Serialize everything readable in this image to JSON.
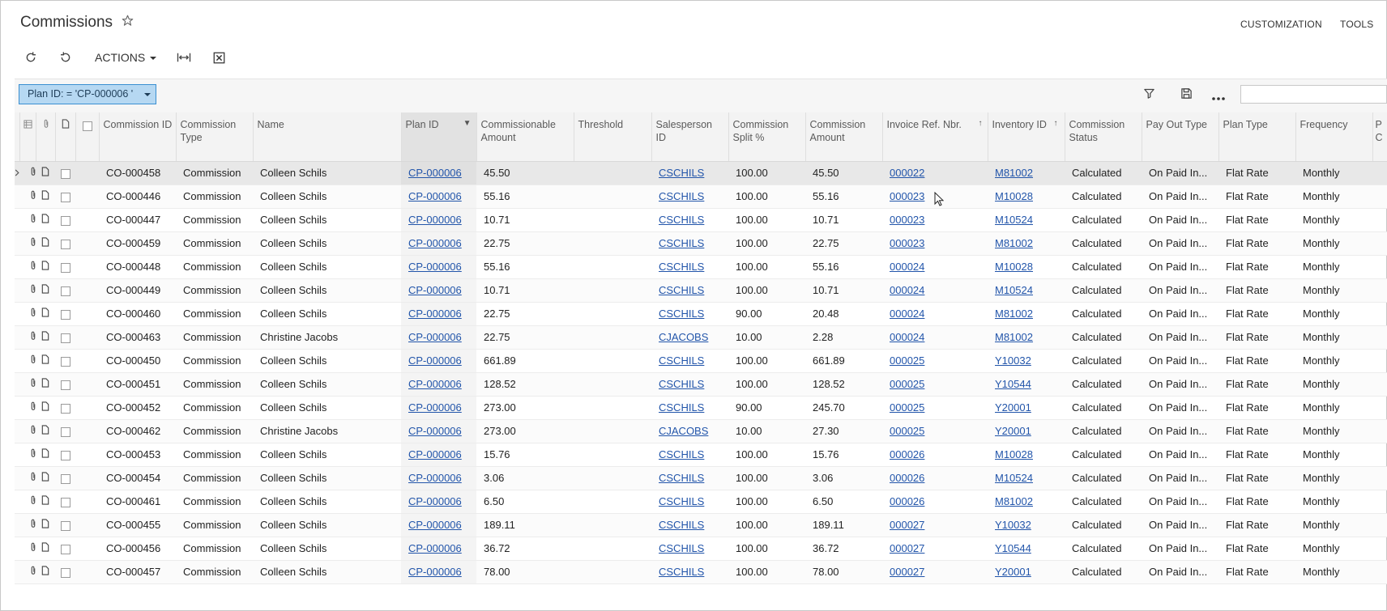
{
  "header": {
    "title": "Commissions",
    "links": [
      "CUSTOMIZATION",
      "TOOLS"
    ]
  },
  "toolbar": {
    "actions_label": "ACTIONS"
  },
  "filter": {
    "chip_label": "Plan ID: = 'CP-000006 '",
    "search_value": ""
  },
  "columns": {
    "commission_id": "Commission ID",
    "commission_type": "Commission Type",
    "name": "Name",
    "plan_id": "Plan ID",
    "commissionable_amount": "Commissionable Amount",
    "threshold": "Threshold",
    "salesperson_id": "Salesperson ID",
    "commission_split": "Commission Split %",
    "commission_amount": "Commission Amount",
    "invoice_ref": "Invoice Ref. Nbr.",
    "inventory_id": "Inventory ID",
    "commission_status": "Commission Status",
    "pay_out_type": "Pay Out Type",
    "plan_type": "Plan Type",
    "frequency": "Frequency",
    "extra": "P C"
  },
  "rows": [
    {
      "id": "CO-000458",
      "type": "Commission",
      "name": "Colleen Schils",
      "plan": "CP-000006",
      "commissionable": "45.50",
      "threshold": "",
      "salesperson": "CSCHILS",
      "split": "100.00",
      "amount": "45.50",
      "invoice": "000022",
      "inventory": "M81002",
      "status": "Calculated",
      "payout": "On Paid In...",
      "plantype": "Flat Rate",
      "frequency": "Monthly"
    },
    {
      "id": "CO-000446",
      "type": "Commission",
      "name": "Colleen Schils",
      "plan": "CP-000006",
      "commissionable": "55.16",
      "threshold": "",
      "salesperson": "CSCHILS",
      "split": "100.00",
      "amount": "55.16",
      "invoice": "000023",
      "inventory": "M10028",
      "status": "Calculated",
      "payout": "On Paid In...",
      "plantype": "Flat Rate",
      "frequency": "Monthly"
    },
    {
      "id": "CO-000447",
      "type": "Commission",
      "name": "Colleen Schils",
      "plan": "CP-000006",
      "commissionable": "10.71",
      "threshold": "",
      "salesperson": "CSCHILS",
      "split": "100.00",
      "amount": "10.71",
      "invoice": "000023",
      "inventory": "M10524",
      "status": "Calculated",
      "payout": "On Paid In...",
      "plantype": "Flat Rate",
      "frequency": "Monthly"
    },
    {
      "id": "CO-000459",
      "type": "Commission",
      "name": "Colleen Schils",
      "plan": "CP-000006",
      "commissionable": "22.75",
      "threshold": "",
      "salesperson": "CSCHILS",
      "split": "100.00",
      "amount": "22.75",
      "invoice": "000023",
      "inventory": "M81002",
      "status": "Calculated",
      "payout": "On Paid In...",
      "plantype": "Flat Rate",
      "frequency": "Monthly"
    },
    {
      "id": "CO-000448",
      "type": "Commission",
      "name": "Colleen Schils",
      "plan": "CP-000006",
      "commissionable": "55.16",
      "threshold": "",
      "salesperson": "CSCHILS",
      "split": "100.00",
      "amount": "55.16",
      "invoice": "000024",
      "inventory": "M10028",
      "status": "Calculated",
      "payout": "On Paid In...",
      "plantype": "Flat Rate",
      "frequency": "Monthly"
    },
    {
      "id": "CO-000449",
      "type": "Commission",
      "name": "Colleen Schils",
      "plan": "CP-000006",
      "commissionable": "10.71",
      "threshold": "",
      "salesperson": "CSCHILS",
      "split": "100.00",
      "amount": "10.71",
      "invoice": "000024",
      "inventory": "M10524",
      "status": "Calculated",
      "payout": "On Paid In...",
      "plantype": "Flat Rate",
      "frequency": "Monthly"
    },
    {
      "id": "CO-000460",
      "type": "Commission",
      "name": "Colleen Schils",
      "plan": "CP-000006",
      "commissionable": "22.75",
      "threshold": "",
      "salesperson": "CSCHILS",
      "split": "90.00",
      "amount": "20.48",
      "invoice": "000024",
      "inventory": "M81002",
      "status": "Calculated",
      "payout": "On Paid In...",
      "plantype": "Flat Rate",
      "frequency": "Monthly"
    },
    {
      "id": "CO-000463",
      "type": "Commission",
      "name": "Christine Jacobs",
      "plan": "CP-000006",
      "commissionable": "22.75",
      "threshold": "",
      "salesperson": "CJACOBS",
      "split": "10.00",
      "amount": "2.28",
      "invoice": "000024",
      "inventory": "M81002",
      "status": "Calculated",
      "payout": "On Paid In...",
      "plantype": "Flat Rate",
      "frequency": "Monthly"
    },
    {
      "id": "CO-000450",
      "type": "Commission",
      "name": "Colleen Schils",
      "plan": "CP-000006",
      "commissionable": "661.89",
      "threshold": "",
      "salesperson": "CSCHILS",
      "split": "100.00",
      "amount": "661.89",
      "invoice": "000025",
      "inventory": "Y10032",
      "status": "Calculated",
      "payout": "On Paid In...",
      "plantype": "Flat Rate",
      "frequency": "Monthly"
    },
    {
      "id": "CO-000451",
      "type": "Commission",
      "name": "Colleen Schils",
      "plan": "CP-000006",
      "commissionable": "128.52",
      "threshold": "",
      "salesperson": "CSCHILS",
      "split": "100.00",
      "amount": "128.52",
      "invoice": "000025",
      "inventory": "Y10544",
      "status": "Calculated",
      "payout": "On Paid In...",
      "plantype": "Flat Rate",
      "frequency": "Monthly"
    },
    {
      "id": "CO-000452",
      "type": "Commission",
      "name": "Colleen Schils",
      "plan": "CP-000006",
      "commissionable": "273.00",
      "threshold": "",
      "salesperson": "CSCHILS",
      "split": "90.00",
      "amount": "245.70",
      "invoice": "000025",
      "inventory": "Y20001",
      "status": "Calculated",
      "payout": "On Paid In...",
      "plantype": "Flat Rate",
      "frequency": "Monthly"
    },
    {
      "id": "CO-000462",
      "type": "Commission",
      "name": "Christine Jacobs",
      "plan": "CP-000006",
      "commissionable": "273.00",
      "threshold": "",
      "salesperson": "CJACOBS",
      "split": "10.00",
      "amount": "27.30",
      "invoice": "000025",
      "inventory": "Y20001",
      "status": "Calculated",
      "payout": "On Paid In...",
      "plantype": "Flat Rate",
      "frequency": "Monthly"
    },
    {
      "id": "CO-000453",
      "type": "Commission",
      "name": "Colleen Schils",
      "plan": "CP-000006",
      "commissionable": "15.76",
      "threshold": "",
      "salesperson": "CSCHILS",
      "split": "100.00",
      "amount": "15.76",
      "invoice": "000026",
      "inventory": "M10028",
      "status": "Calculated",
      "payout": "On Paid In...",
      "plantype": "Flat Rate",
      "frequency": "Monthly"
    },
    {
      "id": "CO-000454",
      "type": "Commission",
      "name": "Colleen Schils",
      "plan": "CP-000006",
      "commissionable": "3.06",
      "threshold": "",
      "salesperson": "CSCHILS",
      "split": "100.00",
      "amount": "3.06",
      "invoice": "000026",
      "inventory": "M10524",
      "status": "Calculated",
      "payout": "On Paid In...",
      "plantype": "Flat Rate",
      "frequency": "Monthly"
    },
    {
      "id": "CO-000461",
      "type": "Commission",
      "name": "Colleen Schils",
      "plan": "CP-000006",
      "commissionable": "6.50",
      "threshold": "",
      "salesperson": "CSCHILS",
      "split": "100.00",
      "amount": "6.50",
      "invoice": "000026",
      "inventory": "M81002",
      "status": "Calculated",
      "payout": "On Paid In...",
      "plantype": "Flat Rate",
      "frequency": "Monthly"
    },
    {
      "id": "CO-000455",
      "type": "Commission",
      "name": "Colleen Schils",
      "plan": "CP-000006",
      "commissionable": "189.11",
      "threshold": "",
      "salesperson": "CSCHILS",
      "split": "100.00",
      "amount": "189.11",
      "invoice": "000027",
      "inventory": "Y10032",
      "status": "Calculated",
      "payout": "On Paid In...",
      "plantype": "Flat Rate",
      "frequency": "Monthly"
    },
    {
      "id": "CO-000456",
      "type": "Commission",
      "name": "Colleen Schils",
      "plan": "CP-000006",
      "commissionable": "36.72",
      "threshold": "",
      "salesperson": "CSCHILS",
      "split": "100.00",
      "amount": "36.72",
      "invoice": "000027",
      "inventory": "Y10544",
      "status": "Calculated",
      "payout": "On Paid In...",
      "plantype": "Flat Rate",
      "frequency": "Monthly"
    },
    {
      "id": "CO-000457",
      "type": "Commission",
      "name": "Colleen Schils",
      "plan": "CP-000006",
      "commissionable": "78.00",
      "threshold": "",
      "salesperson": "CSCHILS",
      "split": "100.00",
      "amount": "78.00",
      "invoice": "000027",
      "inventory": "Y20001",
      "status": "Calculated",
      "payout": "On Paid In...",
      "plantype": "Flat Rate",
      "frequency": "Monthly"
    }
  ],
  "icons": {
    "star": "star-outline-icon",
    "refresh": "refresh-icon",
    "undo": "undo-icon",
    "fit": "fit-columns-icon",
    "excel": "excel-export-icon",
    "filter": "filter-icon",
    "save": "save-icon",
    "more": "more-icon",
    "attach": "paperclip-icon",
    "note": "note-icon"
  },
  "colors": {
    "chip_bg": "#b6d8f2",
    "chip_border": "#3a8fd1",
    "link": "#2255aa"
  }
}
